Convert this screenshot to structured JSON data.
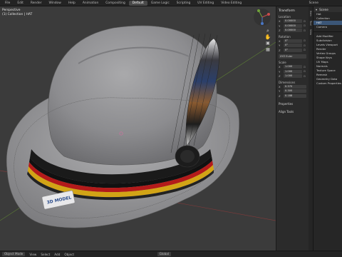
{
  "topbar": {
    "tabs": [
      "File",
      "Edit",
      "Render",
      "Window",
      "Help",
      "Animation",
      "Compositing",
      "Default",
      "Game Logic",
      "Scripting",
      "UV Editing",
      "Video Editing"
    ],
    "active_index": 7,
    "scene_label": "Scene"
  },
  "viewport": {
    "overlay_line1": "Perspective",
    "overlay_line2": "(1) Collection | HAT",
    "tag_text": "3D MODEL"
  },
  "npanel": {
    "transform_title": "Transform",
    "location_label": "Location",
    "location": [
      {
        "axis": "X",
        "value": "0.00000"
      },
      {
        "axis": "Y",
        "value": "0.00000"
      },
      {
        "axis": "Z",
        "value": "0.00000"
      }
    ],
    "rotation_label": "Rotation",
    "rotation": [
      {
        "axis": "X",
        "value": "0°"
      },
      {
        "axis": "Y",
        "value": "0°"
      },
      {
        "axis": "Z",
        "value": "0°"
      }
    ],
    "rotation_mode": "XYZ Euler",
    "scale_label": "Scale",
    "scale": [
      {
        "axis": "X",
        "value": "1.000"
      },
      {
        "axis": "Y",
        "value": "1.000"
      },
      {
        "axis": "Z",
        "value": "1.000"
      }
    ],
    "dimensions_label": "Dimensions",
    "dimensions": [
      {
        "axis": "X",
        "value": "0.370"
      },
      {
        "axis": "Y",
        "value": "0.300"
      },
      {
        "axis": "Z",
        "value": "0.188"
      }
    ],
    "sections": [
      "Properties",
      "Align Tools"
    ]
  },
  "side_tabs": [
    "Item",
    "Tool",
    "View"
  ],
  "outliner": {
    "header": "Scene",
    "rows": [
      "Hat",
      "Collection",
      "HAT",
      "Camera"
    ],
    "selected_index": 2,
    "prop_rows": [
      "Add Modifier",
      "Subdivision",
      "Levels Viewport",
      "Render",
      "Vertex Groups",
      "Shape Keys",
      "UV Maps",
      "Normals",
      "Texture Space",
      "Remesh",
      "Geometry Data",
      "Custom Properties"
    ]
  },
  "bottombar": {
    "items": [
      "Object Mode",
      "View",
      "Select",
      "Add",
      "Object"
    ],
    "transform_orientation": "Global"
  },
  "colors": {
    "accent": "#3b5677",
    "viewport_bg": "#3b3b3b",
    "panel_bg": "#2b2b2b"
  }
}
